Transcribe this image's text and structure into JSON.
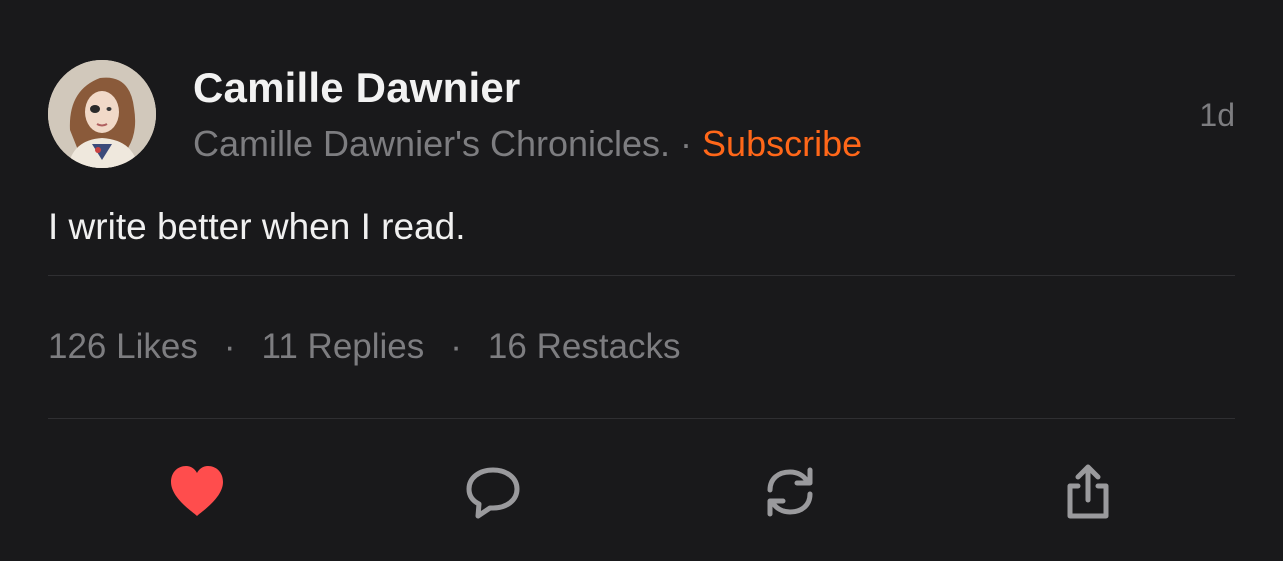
{
  "post": {
    "author": {
      "name": "Camille Dawnier",
      "publication": "Camille Dawnier's Chronicles.",
      "separator": "·",
      "subscribe_label": "Subscribe",
      "avatar_icon": "profile-photo"
    },
    "timestamp": "1d",
    "text": "I write better when I read.",
    "stats": {
      "likes": "126 Likes",
      "replies": "11 Replies",
      "restacks": "16 Restacks",
      "separator": "·"
    },
    "actions": {
      "like_icon": "heart-icon",
      "reply_icon": "speech-bubble-icon",
      "restack_icon": "restack-arrows-icon",
      "share_icon": "share-upload-icon"
    }
  },
  "colors": {
    "background": "#19191b",
    "accent": "#ff6719",
    "like_active": "#ff4d4d",
    "muted_text": "#7d7d80",
    "icon_gray": "#9a9a9d"
  }
}
